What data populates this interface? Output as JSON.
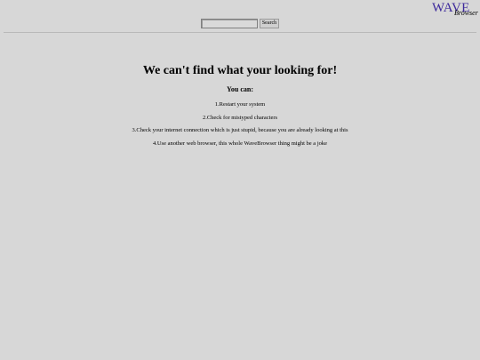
{
  "logo": {
    "wave_text": "WAVE",
    "browser_text": "Browser",
    "wave_color": "#3e2a9c"
  },
  "search": {
    "input_value": "",
    "button_label": "Search"
  },
  "main": {
    "heading": "We can't find what your looking for!",
    "subheading": "You can:",
    "suggestions": [
      "1.Restart your system",
      "2.Check for mistyped characters",
      "3.Check your internet connection which is just stupid, because you are already looking at this",
      "4.Use another web browser, this whole WaveBrowser thing might be a joke"
    ]
  },
  "colors": {
    "background": "#d7d7d7",
    "divider": "#b9b9b9"
  }
}
